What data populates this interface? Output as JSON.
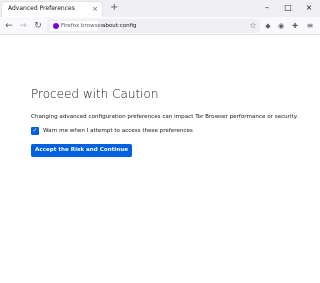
{
  "tab": {
    "title": "Advanced Preferences",
    "close_icon": "×"
  },
  "tabstrip": {
    "new_tab_icon": "+"
  },
  "window_controls": {
    "minimize": "–",
    "maximize": "□",
    "close": "×"
  },
  "toolbar": {
    "back_icon": "←",
    "forward_icon": "→",
    "reload_icon": "↻",
    "identity_label": "Firefox browser",
    "url": "about:config",
    "bookmark_icon": "☆",
    "pocket_icon": "◆",
    "account_icon": "◉",
    "extensions_icon": "✚",
    "menu_icon": "≡"
  },
  "page": {
    "heading": "Proceed with Caution",
    "description": "Changing advanced configuration preferences can impact Tor Browser performance or security.",
    "checkbox_checked": true,
    "checkbox_mark": "✓",
    "checkbox_label": "Warn me when I attempt to access these preferences",
    "accept_button": "Accept the Risk and Continue"
  },
  "colors": {
    "accent": "#0061e0",
    "tabstrip_bg": "#f0f0f4",
    "toolbar_bg": "#f9f9fb"
  }
}
